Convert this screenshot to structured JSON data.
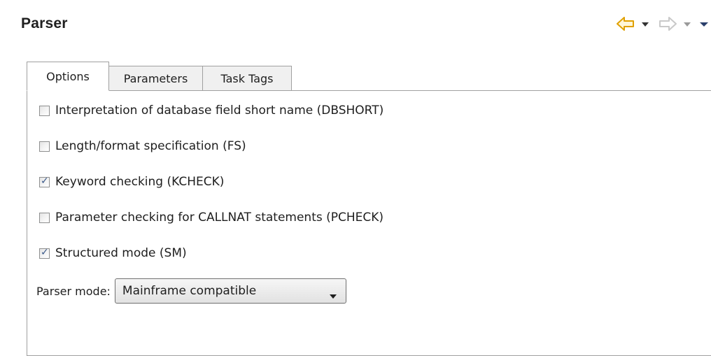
{
  "header": {
    "title": "Parser",
    "back_icon": "back-arrow-icon",
    "forward_icon": "forward-arrow-icon",
    "accent_back": "#e8a800",
    "forward_disabled_color": "#c9c9c9"
  },
  "tabs": [
    {
      "label": "Options",
      "active": true
    },
    {
      "label": "Parameters",
      "active": false
    },
    {
      "label": "Task Tags",
      "active": false
    }
  ],
  "options": [
    {
      "label": "Interpretation of database field short name (DBSHORT)",
      "checked": false
    },
    {
      "label": "Length/format specification (FS)",
      "checked": false
    },
    {
      "label": "Keyword checking (KCHECK)",
      "checked": true
    },
    {
      "label": "Parameter checking for CALLNAT statements (PCHECK)",
      "checked": false
    },
    {
      "label": "Structured mode (SM)",
      "checked": true
    }
  ],
  "parser_mode": {
    "label": "Parser mode:",
    "selected": "Mainframe compatible"
  }
}
